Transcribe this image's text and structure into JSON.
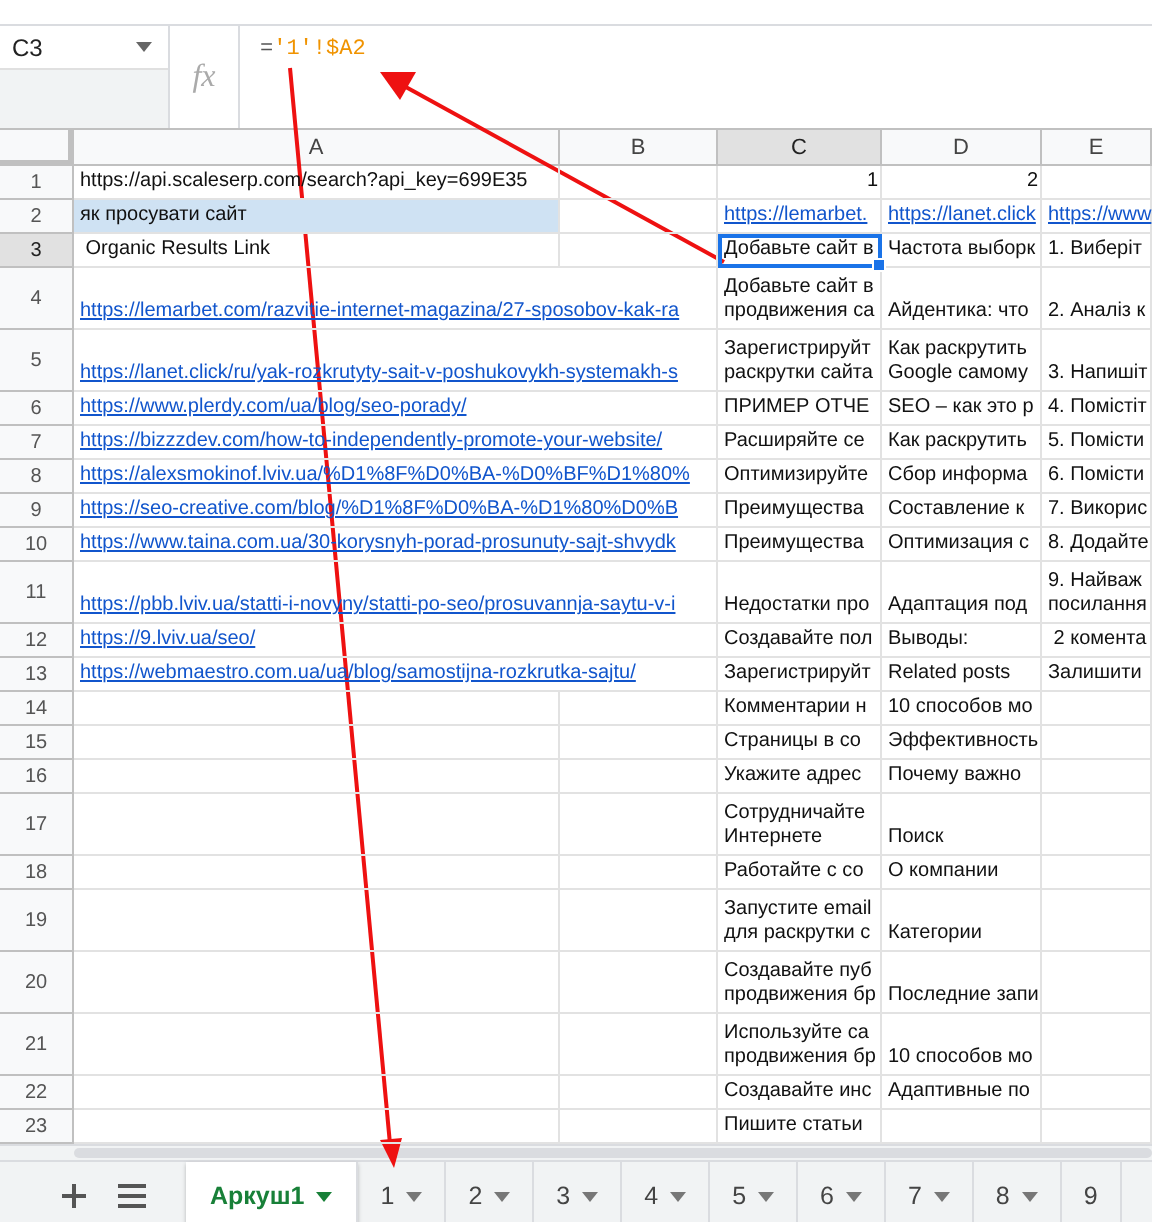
{
  "name_box": {
    "value": "C3"
  },
  "formula": {
    "icon": "fx",
    "prefix": "=",
    "reference": "'1'!$A2"
  },
  "columns": [
    {
      "label": "A",
      "selected": false
    },
    {
      "label": "B",
      "selected": false
    },
    {
      "label": "C",
      "selected": true
    },
    {
      "label": "D",
      "selected": false
    },
    {
      "label": "E",
      "selected": false
    }
  ],
  "rows": [
    {
      "number": "1",
      "selected": false,
      "a": {
        "kind": "text",
        "text": "https://api.scaleserp.com/search?api_key=699E35"
      },
      "c": {
        "kind": "number",
        "text": "1"
      },
      "d": {
        "kind": "number",
        "text": "2"
      }
    },
    {
      "number": "2",
      "selected": false,
      "a": {
        "kind": "highlight",
        "text": "як просувати сайт"
      },
      "c": {
        "kind": "link",
        "text": "https://lemarbet."
      },
      "d": {
        "kind": "link",
        "text": "https://lanet.click"
      },
      "e": {
        "kind": "link",
        "text": "https://www"
      }
    },
    {
      "number": "3",
      "selected": true,
      "a": {
        "kind": "text",
        "text": " Organic Results Link"
      },
      "c": {
        "kind": "text",
        "text": "Добавьте сайт в"
      },
      "d": {
        "kind": "text",
        "text": "Частота выборк"
      },
      "e": {
        "kind": "text",
        "text": "1. Виберіт"
      }
    },
    {
      "number": "4",
      "selected": false,
      "a": {
        "kind": "link",
        "text": "https://lemarbet.com/razvitie-internet-magazina/27-sposobov-kak-ra"
      },
      "c": {
        "kind": "text",
        "text": "Добавьте сайт в\nпродвижения са"
      },
      "d": {
        "kind": "text",
        "text": "Айдентика: что"
      },
      "e": {
        "kind": "text",
        "text": "2. Аналіз к"
      }
    },
    {
      "number": "5",
      "selected": false,
      "a": {
        "kind": "link",
        "text": "https://lanet.click/ru/yak-rozkrutyty-sait-v-poshukovykh-systemakh-s"
      },
      "c": {
        "kind": "text",
        "text": "Зарегистрируйт\nраскрутки сайта"
      },
      "d": {
        "kind": "text",
        "text": "Как раскрутить\nGoogle самому"
      },
      "e": {
        "kind": "text",
        "text": "3. Напишіт"
      }
    },
    {
      "number": "6",
      "selected": false,
      "a": {
        "kind": "link",
        "text": "https://www.plerdy.com/ua/blog/seo-porady/"
      },
      "c": {
        "kind": "text",
        "text": "ПРИМЕР ОТЧЕ"
      },
      "d": {
        "kind": "text",
        "text": "SEO – как это р"
      },
      "e": {
        "kind": "text",
        "text": "4. Помістіт"
      }
    },
    {
      "number": "7",
      "selected": false,
      "a": {
        "kind": "link",
        "text": "https://bizzzdev.com/how-to-independently-promote-your-website/"
      },
      "c": {
        "kind": "text",
        "text": "Расширяйте се"
      },
      "d": {
        "kind": "text",
        "text": "Как раскрутить"
      },
      "e": {
        "kind": "text",
        "text": "5. Помісти"
      }
    },
    {
      "number": "8",
      "selected": false,
      "a": {
        "kind": "link",
        "text": "https://alexsmokinof.lviv.ua/%D1%8F%D0%BA-%D0%BF%D1%80%"
      },
      "c": {
        "kind": "text",
        "text": "Оптимизируйте"
      },
      "d": {
        "kind": "text",
        "text": "Сбор информа"
      },
      "e": {
        "kind": "text",
        "text": "6. Помісти"
      }
    },
    {
      "number": "9",
      "selected": false,
      "a": {
        "kind": "link",
        "text": "https://seo-creative.com/blog/%D1%8F%D0%BA-%D1%80%D0%B"
      },
      "c": {
        "kind": "text",
        "text": "Преимущества"
      },
      "d": {
        "kind": "text",
        "text": "Составление к"
      },
      "e": {
        "kind": "text",
        "text": "7. Викорис"
      }
    },
    {
      "number": "10",
      "selected": false,
      "a": {
        "kind": "link",
        "text": "https://www.taina.com.ua/30-korysnyh-porad-prosunuty-sajt-shvydk"
      },
      "c": {
        "kind": "text",
        "text": "Преимущества"
      },
      "d": {
        "kind": "text",
        "text": "Оптимизация с"
      },
      "e": {
        "kind": "text",
        "text": "8. Додайте"
      }
    },
    {
      "number": "11",
      "selected": false,
      "a": {
        "kind": "link",
        "text": "https://pbb.lviv.ua/statti-i-novyny/statti-po-seo/prosuvannja-saytu-v-i"
      },
      "c": {
        "kind": "text",
        "text": "Недостатки про"
      },
      "d": {
        "kind": "text",
        "text": "Адаптация под"
      },
      "e": {
        "kind": "text",
        "text": "9. Найваж\nпосилання"
      }
    },
    {
      "number": "12",
      "selected": false,
      "a": {
        "kind": "link",
        "text": "https://9.lviv.ua/seo/"
      },
      "c": {
        "kind": "text",
        "text": "Создавайте пол"
      },
      "d": {
        "kind": "text",
        "text": "Выводы:"
      },
      "e": {
        "kind": "text",
        "text": " 2 комента"
      }
    },
    {
      "number": "13",
      "selected": false,
      "a": {
        "kind": "link",
        "text": "https://webmaestro.com.ua/ua/blog/samostijna-rozkrutka-sajtu/"
      },
      "c": {
        "kind": "text",
        "text": "Зарегистрируйт"
      },
      "d": {
        "kind": "text",
        "text": "Related posts"
      },
      "e": {
        "kind": "text",
        "text": "Залишити"
      }
    },
    {
      "number": "14",
      "selected": false,
      "c": {
        "kind": "text",
        "text": "Комментарии н"
      },
      "d": {
        "kind": "text",
        "text": "10 способов мо"
      }
    },
    {
      "number": "15",
      "selected": false,
      "c": {
        "kind": "text",
        "text": "Страницы в со"
      },
      "d": {
        "kind": "text",
        "text": "Эффективность"
      }
    },
    {
      "number": "16",
      "selected": false,
      "c": {
        "kind": "text",
        "text": "Укажите адрес"
      },
      "d": {
        "kind": "text",
        "text": "Почему важно"
      }
    },
    {
      "number": "17",
      "selected": false,
      "c": {
        "kind": "text",
        "text": "Сотрудничайте\nИнтернете"
      },
      "d": {
        "kind": "text",
        "text": "Поиск"
      }
    },
    {
      "number": "18",
      "selected": false,
      "c": {
        "kind": "text",
        "text": "Работайте с со"
      },
      "d": {
        "kind": "text",
        "text": "О компании"
      }
    },
    {
      "number": "19",
      "selected": false,
      "c": {
        "kind": "text",
        "text": "Запустите email\nдля раскрутки с"
      },
      "d": {
        "kind": "text",
        "text": "Категории"
      }
    },
    {
      "number": "20",
      "selected": false,
      "c": {
        "kind": "text",
        "text": "Создавайте пуб\nпродвижения бр"
      },
      "d": {
        "kind": "text",
        "text": "Последние запи"
      }
    },
    {
      "number": "21",
      "selected": false,
      "c": {
        "kind": "text",
        "text": "Используйте са\nпродвижения бр"
      },
      "d": {
        "kind": "text",
        "text": "10 способов мо"
      }
    },
    {
      "number": "22",
      "selected": false,
      "c": {
        "kind": "text",
        "text": "Создавайте инс"
      },
      "d": {
        "kind": "text",
        "text": "Адаптивные по"
      }
    },
    {
      "number": "23",
      "selected": false,
      "c": {
        "kind": "text",
        "text": "Пишите статьи"
      }
    }
  ],
  "sheet_tabs": [
    {
      "label": "Аркуш1",
      "selected": true
    },
    {
      "label": "1",
      "selected": false
    },
    {
      "label": "2",
      "selected": false
    },
    {
      "label": "3",
      "selected": false
    },
    {
      "label": "4",
      "selected": false
    },
    {
      "label": "5",
      "selected": false
    },
    {
      "label": "6",
      "selected": false
    },
    {
      "label": "7",
      "selected": false
    },
    {
      "label": "8",
      "selected": false
    },
    {
      "label": "9",
      "selected": false
    }
  ]
}
